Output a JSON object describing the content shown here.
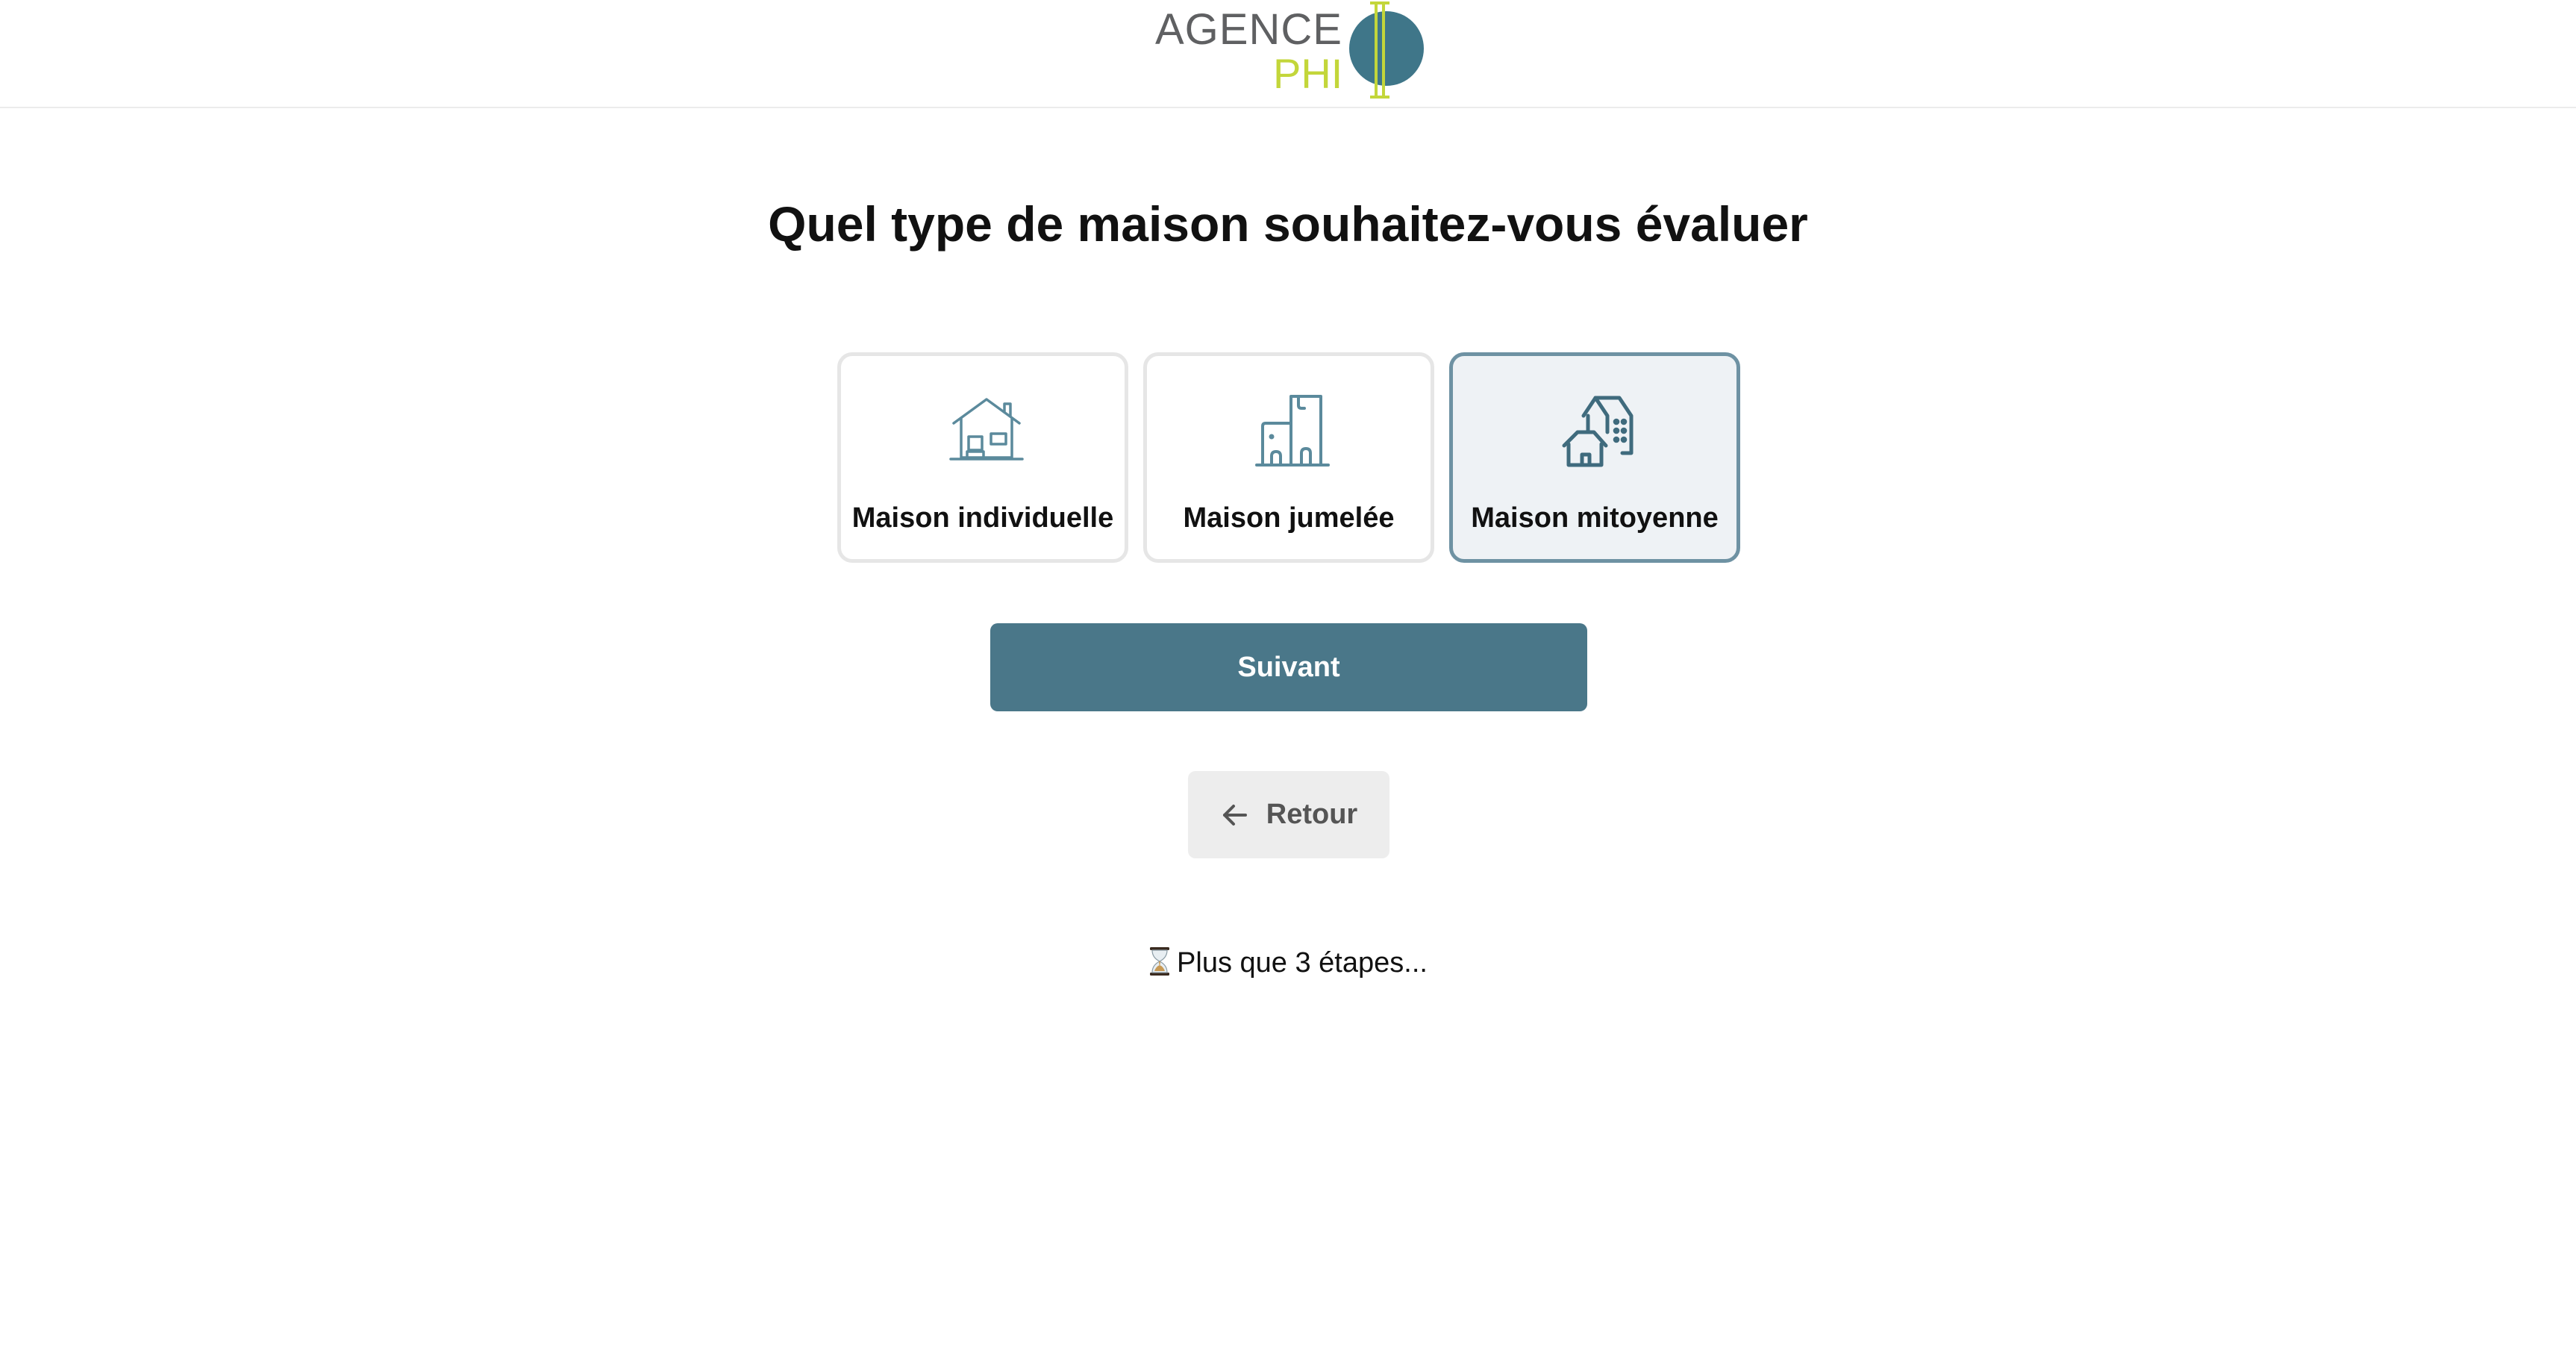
{
  "header": {
    "logo": {
      "word1": "AGENCE",
      "word2": "PHI",
      "icon": "phi-logo-icon",
      "colors": {
        "gray": "#5f6062",
        "green": "#c3d63a",
        "teal": "#3f7689"
      }
    }
  },
  "main": {
    "title": "Quel type de maison souhaitez-vous évaluer",
    "options": [
      {
        "label": "Maison individuelle",
        "icon": "detached-house-icon",
        "selected": false
      },
      {
        "label": "Maison jumelée",
        "icon": "semi-detached-house-icon",
        "selected": false
      },
      {
        "label": "Maison mitoyenne",
        "icon": "terraced-house-icon",
        "selected": true
      }
    ],
    "next_label": "Suivant",
    "back_label": "Retour",
    "back_icon": "arrow-left-icon",
    "steps_icon": "hourglass-icon",
    "steps_text": "Plus que 3 étapes..."
  },
  "colors": {
    "primary": "#4a7789",
    "selected_border": "#6e92a3",
    "selected_bg": "#eef2f5",
    "icon_stroke": "#5b8a9c"
  }
}
